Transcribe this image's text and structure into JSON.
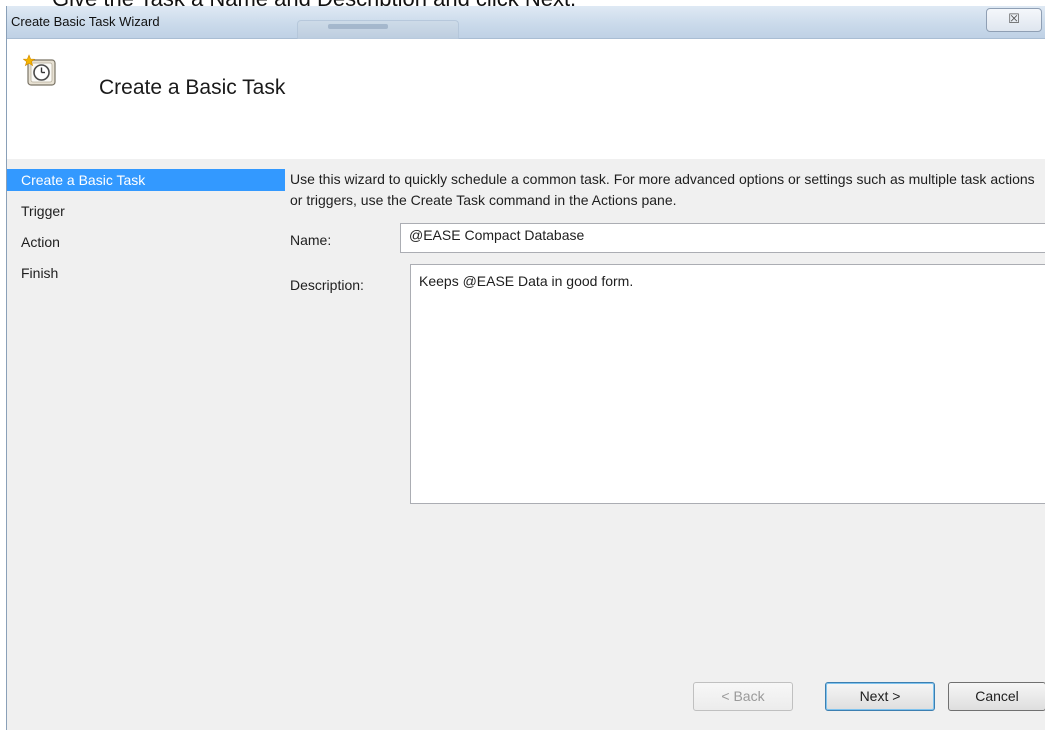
{
  "caption": "Give the Task a Name and Description and click Next.",
  "window": {
    "title": "Create Basic Task Wizard",
    "close_glyph": "☒"
  },
  "header": {
    "title": "Create a Basic Task",
    "icon": "task-clock-icon"
  },
  "nav": {
    "items": [
      {
        "label": "Create a Basic Task",
        "active": true
      },
      {
        "label": "Trigger",
        "active": false
      },
      {
        "label": "Action",
        "active": false
      },
      {
        "label": "Finish",
        "active": false
      }
    ]
  },
  "main": {
    "intro": "Use this wizard to quickly schedule a common task.  For more advanced options or settings such as multiple task actions or triggers, use the Create Task command in the Actions pane.",
    "name_label": "Name:",
    "name_value": "@EASE Compact Database",
    "description_label": "Description:",
    "description_value": "Keeps @EASE Data in good form."
  },
  "buttons": {
    "back": "< Back",
    "next": "Next >",
    "cancel": "Cancel"
  },
  "colors": {
    "selection": "#3399ff",
    "panel": "#f0f0f0",
    "titlebar": "#c9d9ea"
  }
}
